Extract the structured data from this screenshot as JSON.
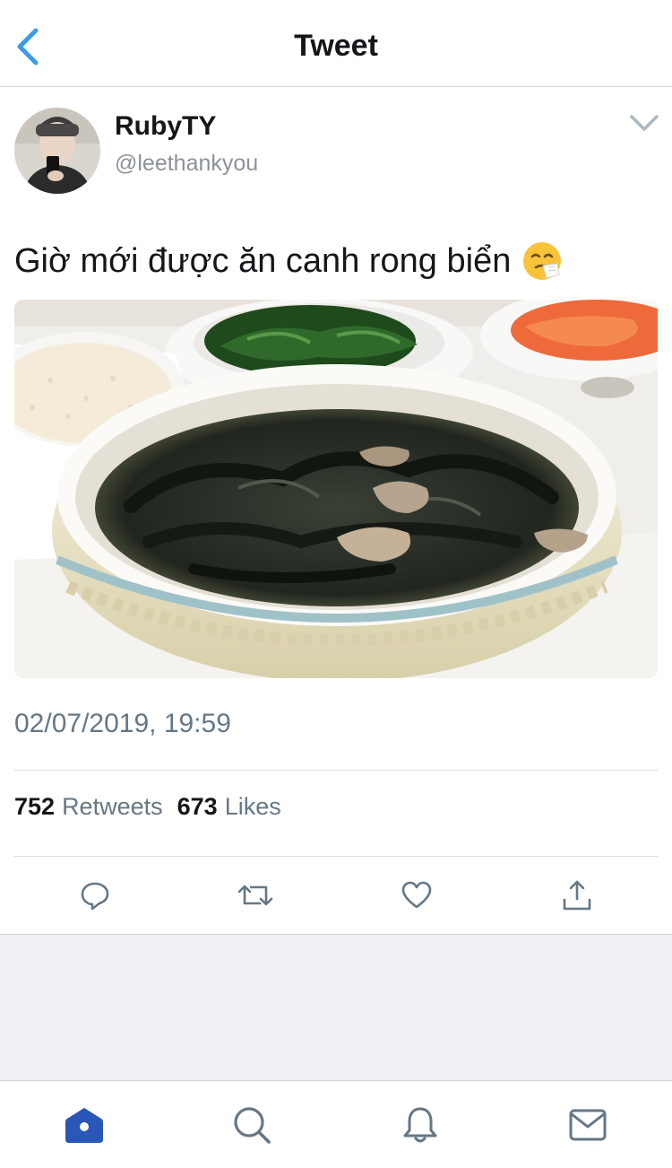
{
  "header": {
    "title": "Tweet",
    "back_icon": "chevron-left-icon"
  },
  "author": {
    "display_name": "RubyTY",
    "handle": "@leethankyou"
  },
  "tweet": {
    "text": "Giờ mới được ăn canh rong biển",
    "emoji": "sneezing-face-emoji",
    "photo_alt": "photo",
    "timestamp": "02/07/2019, 19:59"
  },
  "stats": {
    "retweets_count": "752",
    "retweets_label": "Retweets",
    "likes_count": "673",
    "likes_label": "Likes"
  },
  "actions": [
    "reply-icon",
    "retweet-icon",
    "like-icon",
    "share-icon"
  ],
  "tabbar": [
    "home-icon",
    "search-icon",
    "notifications-icon",
    "messages-icon"
  ],
  "colors": {
    "accent": "#1da1f2",
    "active_tab": "#2a5cc6",
    "secondary_text": "#657786",
    "icon": "#657786"
  }
}
